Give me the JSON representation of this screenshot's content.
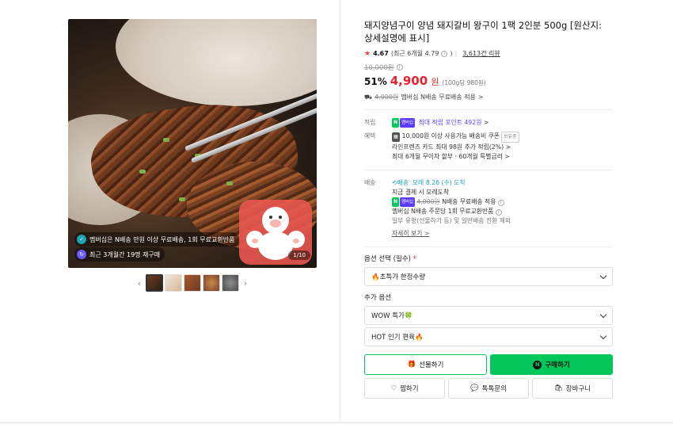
{
  "product": {
    "title": "돼지양념구이 양념 돼지갈비 왕구이 1팩 2인분 500g [원산지: 상세설명에 표시]",
    "rating": "4.67",
    "rating_recent": "(최근 6개월 4.79",
    "rating_recent_close": ")",
    "review_count": "3,613건 리뷰",
    "original_price": "10,000원",
    "discount": "51%",
    "price": "4,900",
    "price_unit": "원",
    "per_100g": "(100g당 980원)",
    "ship_fee_orig": "4,000원",
    "ship_fee_text": "멤버십 N배송 무료배송 적용",
    "ship_fee_more": ">"
  },
  "image": {
    "badge1": "멤버십은 N배송 만원 이상 무료배송, 1회 무료교환반품",
    "badge2": "최근 3개월간 19명 재구매",
    "counter": "1/10",
    "prev_arrow": "‹",
    "next_arrow": "›",
    "thumb_count": 5
  },
  "benefits": {
    "point_label": "적립",
    "point_value": "최대 적립 포인트 492원",
    "point_more": ">",
    "benefit_label": "혜택",
    "benefit1": "10,000원 이상 사용가능 배송비 쿠폰",
    "benefit1_tag": "보유중",
    "benefit2": "라인프렌즈 카드 최대 98원 추가 적립(2%) >",
    "benefit3": "최대 6개월 무이자 할부 · 60개월 특별금리 >"
  },
  "delivery": {
    "label": "배송",
    "badge": "배송",
    "arrival": "모레 8.26 (수) 도착",
    "pay_note": "지금 결제 시 모레도착",
    "fee_orig": "4,000원",
    "fee_text": "N배송 무료배송 적용",
    "exchange": "멤버십 N배송 주문당 1회 무료교환반품",
    "exclude": "일부 유형(선물하기 등) 및 일반배송 전환 제외",
    "more": "자세히 보기 >"
  },
  "options": {
    "required_label": "옵션 선택 (필수)",
    "required_mark": "*",
    "required_value": "🔥초특가 한정수량",
    "additional_label": "추가 옵션",
    "add1": "WOW 특가🍀",
    "add2": "HOT 인기 편육🔥"
  },
  "buttons": {
    "gift": "선물하기",
    "buy": "구매하기",
    "wish": "찜하기",
    "talk": "톡톡문의",
    "cart": "장바구니"
  },
  "colors": {
    "accent": "#03c75a",
    "price": "#e8232b",
    "membership": "#5b3cff"
  }
}
